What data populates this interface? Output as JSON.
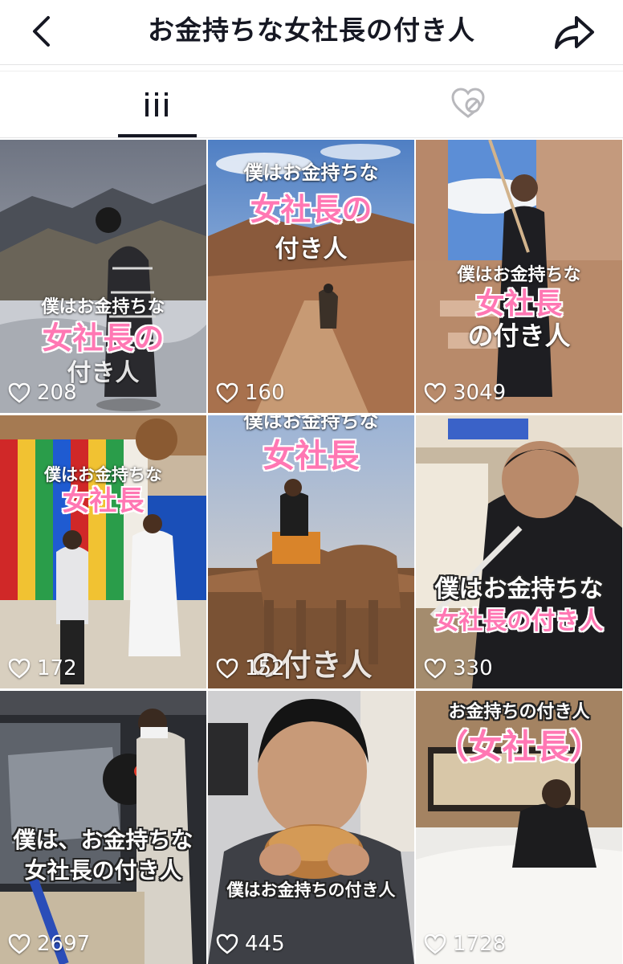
{
  "header": {
    "title": "お金持ちな女社長の付き人"
  },
  "tabs": [
    {
      "name": "videos",
      "icon": "grid-lines-icon",
      "active": true
    },
    {
      "name": "liked",
      "icon": "heart-hidden-icon",
      "active": false
    }
  ],
  "colors": {
    "text": "#161823",
    "caption_pink": "#ff77b3"
  },
  "videos": [
    {
      "likes": "208",
      "captions": [
        "僕はお金持ちな",
        "女社長の",
        "付き人"
      ]
    },
    {
      "likes": "160",
      "captions": [
        "僕はお金持ちな",
        "女社長の",
        "付き人"
      ]
    },
    {
      "likes": "3049",
      "captions": [
        "僕はお金持ちな",
        "女社長",
        "の付き人"
      ]
    },
    {
      "likes": "172",
      "captions": [
        "僕はお金持ちな",
        "女社長"
      ]
    },
    {
      "likes": "152",
      "captions": [
        "僕はお金持ちな",
        "女社長",
        "の付き人"
      ]
    },
    {
      "likes": "330",
      "captions": [
        "僕はお金持ちな",
        "女社長の付き人"
      ]
    },
    {
      "likes": "2697",
      "captions": [
        "僕は、お金持ちな",
        "女社長の付き人"
      ]
    },
    {
      "likes": "445",
      "captions": [
        "僕はお金持ちの付き人"
      ]
    },
    {
      "likes": "1728",
      "captions": [
        "お金持ちの付き人",
        "（女社長）"
      ]
    }
  ]
}
